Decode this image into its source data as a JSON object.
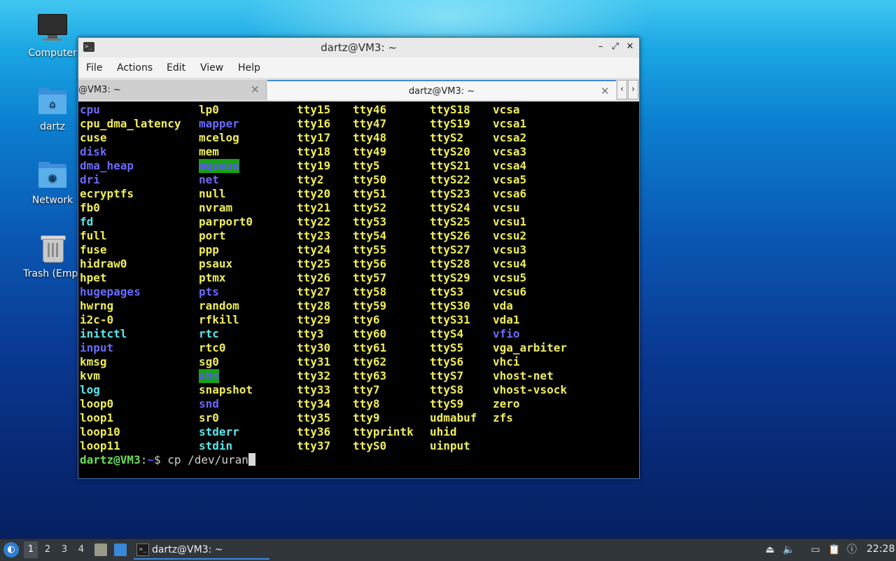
{
  "desktop": {
    "icons": [
      {
        "label": "Computer"
      },
      {
        "label": "dartz"
      },
      {
        "label": "Network"
      },
      {
        "label": "Trash (Empt"
      }
    ]
  },
  "window": {
    "title": "dartz@VM3: ~",
    "controls": {
      "minimize": "–",
      "maximize": "⤢",
      "close": "✕"
    },
    "menu": [
      "File",
      "Actions",
      "Edit",
      "View",
      "Help"
    ],
    "tabs": [
      {
        "label": "@VM3: ~",
        "close": "✕",
        "active": false
      },
      {
        "label": "dartz@VM3: ~",
        "close": "✕",
        "active": true
      }
    ],
    "tab_scroll": {
      "left": "‹",
      "right": "›"
    }
  },
  "terminal": {
    "columns": [
      [
        {
          "t": "cpu",
          "c": "blue"
        },
        {
          "t": "cpu_dma_latency",
          "c": "yellow"
        },
        {
          "t": "cuse",
          "c": "yellow"
        },
        {
          "t": "disk",
          "c": "blue"
        },
        {
          "t": "dma_heap",
          "c": "blue"
        },
        {
          "t": "dri",
          "c": "blue"
        },
        {
          "t": "ecryptfs",
          "c": "yellow"
        },
        {
          "t": "fb0",
          "c": "yellow"
        },
        {
          "t": "fd",
          "c": "cyan"
        },
        {
          "t": "full",
          "c": "yellow"
        },
        {
          "t": "fuse",
          "c": "yellow"
        },
        {
          "t": "hidraw0",
          "c": "yellow"
        },
        {
          "t": "hpet",
          "c": "yellow"
        },
        {
          "t": "hugepages",
          "c": "blue"
        },
        {
          "t": "hwrng",
          "c": "yellow"
        },
        {
          "t": "i2c-0",
          "c": "yellow"
        },
        {
          "t": "initctl",
          "c": "cyan"
        },
        {
          "t": "input",
          "c": "blue"
        },
        {
          "t": "kmsg",
          "c": "yellow"
        },
        {
          "t": "kvm",
          "c": "yellow"
        },
        {
          "t": "log",
          "c": "cyan"
        },
        {
          "t": "loop0",
          "c": "yellow"
        },
        {
          "t": "loop1",
          "c": "yellow"
        },
        {
          "t": "loop10",
          "c": "yellow"
        },
        {
          "t": "loop11",
          "c": "yellow"
        }
      ],
      [
        {
          "t": "lp0",
          "c": "yellow"
        },
        {
          "t": "mapper",
          "c": "blue"
        },
        {
          "t": "mcelog",
          "c": "yellow"
        },
        {
          "t": "mem",
          "c": "yellow"
        },
        {
          "t": "mqueue",
          "c": "green-bg"
        },
        {
          "t": "net",
          "c": "blue"
        },
        {
          "t": "null",
          "c": "yellow"
        },
        {
          "t": "nvram",
          "c": "yellow"
        },
        {
          "t": "parport0",
          "c": "yellow"
        },
        {
          "t": "port",
          "c": "yellow"
        },
        {
          "t": "ppp",
          "c": "yellow"
        },
        {
          "t": "psaux",
          "c": "yellow"
        },
        {
          "t": "ptmx",
          "c": "yellow"
        },
        {
          "t": "pts",
          "c": "blue"
        },
        {
          "t": "random",
          "c": "yellow"
        },
        {
          "t": "rfkill",
          "c": "yellow"
        },
        {
          "t": "rtc",
          "c": "cyan"
        },
        {
          "t": "rtc0",
          "c": "yellow"
        },
        {
          "t": "sg0",
          "c": "yellow"
        },
        {
          "t": "shm",
          "c": "green-bg"
        },
        {
          "t": "snapshot",
          "c": "yellow"
        },
        {
          "t": "snd",
          "c": "blue"
        },
        {
          "t": "sr0",
          "c": "yellow"
        },
        {
          "t": "stderr",
          "c": "cyan"
        },
        {
          "t": "stdin",
          "c": "cyan"
        }
      ],
      [
        {
          "t": "tty15",
          "c": "yellow"
        },
        {
          "t": "tty16",
          "c": "yellow"
        },
        {
          "t": "tty17",
          "c": "yellow"
        },
        {
          "t": "tty18",
          "c": "yellow"
        },
        {
          "t": "tty19",
          "c": "yellow"
        },
        {
          "t": "tty2",
          "c": "yellow"
        },
        {
          "t": "tty20",
          "c": "yellow"
        },
        {
          "t": "tty21",
          "c": "yellow"
        },
        {
          "t": "tty22",
          "c": "yellow"
        },
        {
          "t": "tty23",
          "c": "yellow"
        },
        {
          "t": "tty24",
          "c": "yellow"
        },
        {
          "t": "tty25",
          "c": "yellow"
        },
        {
          "t": "tty26",
          "c": "yellow"
        },
        {
          "t": "tty27",
          "c": "yellow"
        },
        {
          "t": "tty28",
          "c": "yellow"
        },
        {
          "t": "tty29",
          "c": "yellow"
        },
        {
          "t": "tty3",
          "c": "yellow"
        },
        {
          "t": "tty30",
          "c": "yellow"
        },
        {
          "t": "tty31",
          "c": "yellow"
        },
        {
          "t": "tty32",
          "c": "yellow"
        },
        {
          "t": "tty33",
          "c": "yellow"
        },
        {
          "t": "tty34",
          "c": "yellow"
        },
        {
          "t": "tty35",
          "c": "yellow"
        },
        {
          "t": "tty36",
          "c": "yellow"
        },
        {
          "t": "tty37",
          "c": "yellow"
        }
      ],
      [
        {
          "t": "tty46",
          "c": "yellow"
        },
        {
          "t": "tty47",
          "c": "yellow"
        },
        {
          "t": "tty48",
          "c": "yellow"
        },
        {
          "t": "tty49",
          "c": "yellow"
        },
        {
          "t": "tty5",
          "c": "yellow"
        },
        {
          "t": "tty50",
          "c": "yellow"
        },
        {
          "t": "tty51",
          "c": "yellow"
        },
        {
          "t": "tty52",
          "c": "yellow"
        },
        {
          "t": "tty53",
          "c": "yellow"
        },
        {
          "t": "tty54",
          "c": "yellow"
        },
        {
          "t": "tty55",
          "c": "yellow"
        },
        {
          "t": "tty56",
          "c": "yellow"
        },
        {
          "t": "tty57",
          "c": "yellow"
        },
        {
          "t": "tty58",
          "c": "yellow"
        },
        {
          "t": "tty59",
          "c": "yellow"
        },
        {
          "t": "tty6",
          "c": "yellow"
        },
        {
          "t": "tty60",
          "c": "yellow"
        },
        {
          "t": "tty61",
          "c": "yellow"
        },
        {
          "t": "tty62",
          "c": "yellow"
        },
        {
          "t": "tty63",
          "c": "yellow"
        },
        {
          "t": "tty7",
          "c": "yellow"
        },
        {
          "t": "tty8",
          "c": "yellow"
        },
        {
          "t": "tty9",
          "c": "yellow"
        },
        {
          "t": "ttyprintk",
          "c": "yellow"
        },
        {
          "t": "ttyS0",
          "c": "yellow"
        }
      ],
      [
        {
          "t": "ttyS18",
          "c": "yellow"
        },
        {
          "t": "ttyS19",
          "c": "yellow"
        },
        {
          "t": "ttyS2",
          "c": "yellow"
        },
        {
          "t": "ttyS20",
          "c": "yellow"
        },
        {
          "t": "ttyS21",
          "c": "yellow"
        },
        {
          "t": "ttyS22",
          "c": "yellow"
        },
        {
          "t": "ttyS23",
          "c": "yellow"
        },
        {
          "t": "ttyS24",
          "c": "yellow"
        },
        {
          "t": "ttyS25",
          "c": "yellow"
        },
        {
          "t": "ttyS26",
          "c": "yellow"
        },
        {
          "t": "ttyS27",
          "c": "yellow"
        },
        {
          "t": "ttyS28",
          "c": "yellow"
        },
        {
          "t": "ttyS29",
          "c": "yellow"
        },
        {
          "t": "ttyS3",
          "c": "yellow"
        },
        {
          "t": "ttyS30",
          "c": "yellow"
        },
        {
          "t": "ttyS31",
          "c": "yellow"
        },
        {
          "t": "ttyS4",
          "c": "yellow"
        },
        {
          "t": "ttyS5",
          "c": "yellow"
        },
        {
          "t": "ttyS6",
          "c": "yellow"
        },
        {
          "t": "ttyS7",
          "c": "yellow"
        },
        {
          "t": "ttyS8",
          "c": "yellow"
        },
        {
          "t": "ttyS9",
          "c": "yellow"
        },
        {
          "t": "udmabuf",
          "c": "yellow"
        },
        {
          "t": "uhid",
          "c": "yellow"
        },
        {
          "t": "uinput",
          "c": "yellow"
        }
      ],
      [
        {
          "t": "vcsa",
          "c": "yellow"
        },
        {
          "t": "vcsa1",
          "c": "yellow"
        },
        {
          "t": "vcsa2",
          "c": "yellow"
        },
        {
          "t": "vcsa3",
          "c": "yellow"
        },
        {
          "t": "vcsa4",
          "c": "yellow"
        },
        {
          "t": "vcsa5",
          "c": "yellow"
        },
        {
          "t": "vcsa6",
          "c": "yellow"
        },
        {
          "t": "vcsu",
          "c": "yellow"
        },
        {
          "t": "vcsu1",
          "c": "yellow"
        },
        {
          "t": "vcsu2",
          "c": "yellow"
        },
        {
          "t": "vcsu3",
          "c": "yellow"
        },
        {
          "t": "vcsu4",
          "c": "yellow"
        },
        {
          "t": "vcsu5",
          "c": "yellow"
        },
        {
          "t": "vcsu6",
          "c": "yellow"
        },
        {
          "t": "vda",
          "c": "yellow"
        },
        {
          "t": "vda1",
          "c": "yellow"
        },
        {
          "t": "vfio",
          "c": "blue"
        },
        {
          "t": "vga_arbiter",
          "c": "yellow"
        },
        {
          "t": "vhci",
          "c": "yellow"
        },
        {
          "t": "vhost-net",
          "c": "yellow"
        },
        {
          "t": "vhost-vsock",
          "c": "yellow"
        },
        {
          "t": "zero",
          "c": "yellow"
        },
        {
          "t": "zfs",
          "c": "yellow"
        }
      ]
    ],
    "prompt": {
      "user_host": "dartz@VM3",
      "sep": ":",
      "path": "~",
      "symbol": "$ ",
      "command": "cp /dev/uran"
    }
  },
  "taskbar": {
    "workspaces": [
      "1",
      "2",
      "3",
      "4"
    ],
    "active_workspace": "1",
    "task_label": "dartz@VM3: ~",
    "clock": "22:28"
  },
  "colors": {
    "blue": "#6a6afa",
    "yellow": "#f0ed5a",
    "cyan": "#5ae7ea",
    "green_bg": "#18a018",
    "accent": "#3d8be0"
  }
}
